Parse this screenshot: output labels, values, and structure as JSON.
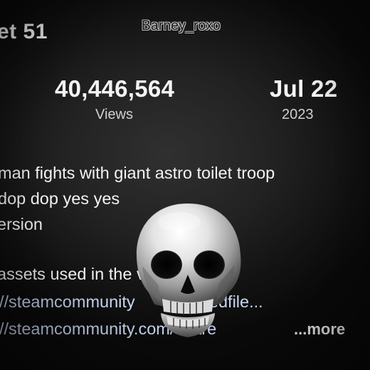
{
  "header": {
    "title_fragment": "et 51",
    "watermark": "Barney_roxo"
  },
  "stats": {
    "views": {
      "value": "40,446,564",
      "label": "Views"
    },
    "date": {
      "value": "Jul 22",
      "label": "2023"
    }
  },
  "description": {
    "lines": [
      "man fights with giant astro toilet troop",
      "dop dop yes yes",
      "ersion",
      "assets used in the vid"
    ],
    "links": [
      "//steamcommunity",
      "/sharedfile...",
      "//steamcommunity.com/share"
    ],
    "more_label": "...more"
  },
  "overlay": {
    "icon": "skull-icon",
    "color": "#e6e6e6"
  }
}
